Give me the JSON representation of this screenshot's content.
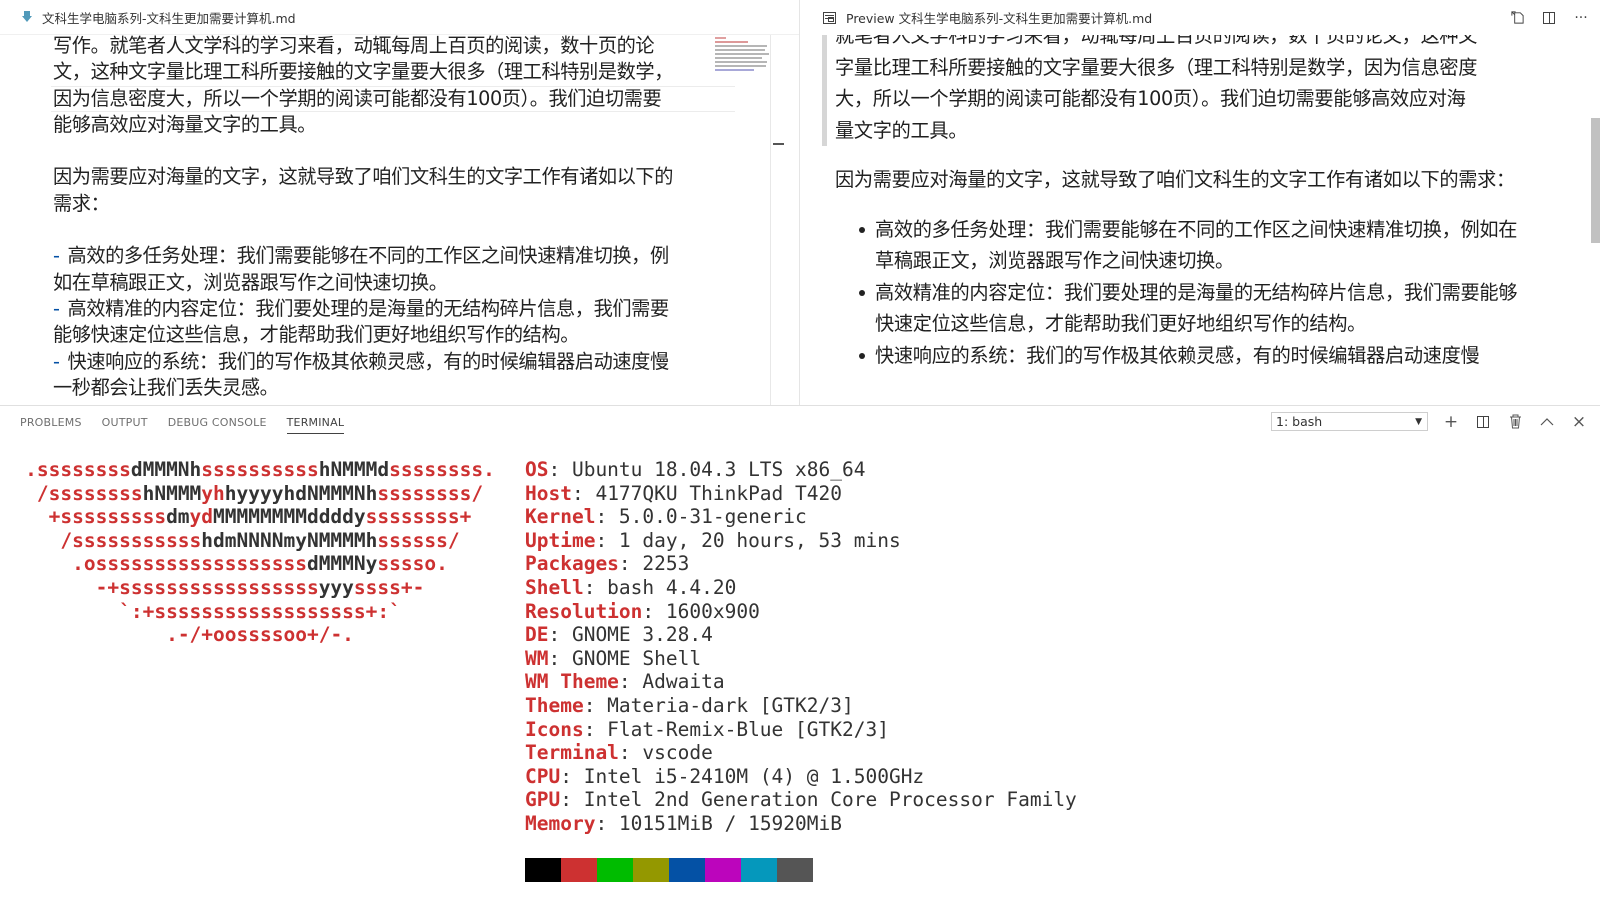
{
  "editor": {
    "tab_title": "文科生学电脑系列-文科生更加需要计算机.md",
    "lines": [
      "写作。就笔者人文学科的学习来看，动辄每周上百页的阅读，数十页的论",
      "文，这种文字量比理工科所要接触的文字量要大很多（理工科特别是数学，",
      "因为信息密度大，所以一个学期的阅读可能都没有100页）。我们迫切需要",
      "能够高效应对海量文字的工具。",
      "因为需要应对海量的文字，这就导致了咱们文科生的文字工作有诸如以下的",
      "需求：",
      "-",
      "高效的多任务处理：我们需要能够在不同的工作区之间快速精准切换，例",
      "如在草稿跟正文，浏览器跟写作之间快速切换。",
      "高效精准的内容定位：我们要处理的是海量的无结构碎片信息，我们需要",
      "能够快速定位这些信息，才能帮助我们更好地组织写作的结构。",
      "快速响应的系统：我们的写作极其依赖灵感，有的时候编辑器启动速度慢",
      "一秒都会让我们丢失灵感。"
    ]
  },
  "preview": {
    "tab_title": "Preview 文科生学电脑系列-文科生更加需要计算机.md",
    "actions": {
      "open_source": "open-source-icon",
      "split": "split-editor-icon",
      "more": "···"
    },
    "quote_lines": [
      "就笔者人文学科的学习来看，动辄每周上百页的阅读，数十页的论文，这种文",
      "字量比理工科所要接触的文字量要大很多（理工科特别是数学，因为信息密度",
      "大，所以一个学期的阅读可能都没有100页）。我们迫切需要能够高效应对海",
      "量文字的工具。"
    ],
    "paragraph": "因为需要应对海量的文字，这就导致了咱们文科生的文字工作有诸如以下的需求：",
    "list": [
      "高效的多任务处理：我们需要能够在不同的工作区之间快速精准切换，例如在草稿跟正文，浏览器跟写作之间快速切换。",
      "高效精准的内容定位：我们要处理的是海量的无结构碎片信息，我们需要能够快速定位这些信息，才能帮助我们更好地组织写作的结构。",
      "快速响应的系统：我们的写作极其依赖灵感，有的时候编辑器启动速度慢"
    ]
  },
  "panel": {
    "tabs": [
      "PROBLEMS",
      "OUTPUT",
      "DEBUG CONSOLE",
      "TERMINAL"
    ],
    "active_tab": "TERMINAL",
    "terminal_select": "1: bash",
    "actions": {
      "new": "+",
      "more_up": "^",
      "close": "×"
    }
  },
  "terminal": {
    "logo": [
      [
        {
          "t": ".ssssssss",
          "c": "r"
        },
        {
          "t": "dMMMNh",
          "c": "k"
        },
        {
          "t": "ssssssssss",
          "c": "r"
        },
        {
          "t": "hNMMMd",
          "c": "k"
        },
        {
          "t": "ssssssss.",
          "c": "r"
        }
      ],
      [
        {
          "t": "/ssssssss",
          "c": "r"
        },
        {
          "t": "hNMMM",
          "c": "k"
        },
        {
          "t": "yh",
          "c": "r"
        },
        {
          "t": "hyyyyhdNMMMNh",
          "c": "k"
        },
        {
          "t": "ssssssss/",
          "c": "r"
        }
      ],
      [
        {
          "t": "+sssssssss",
          "c": "r"
        },
        {
          "t": "dm",
          "c": "k"
        },
        {
          "t": "yd",
          "c": "r"
        },
        {
          "t": "MMMMMMMMddddy",
          "c": "k"
        },
        {
          "t": "ssssssss+",
          "c": "r"
        }
      ],
      [
        {
          "t": "/sssssssssss",
          "c": "r"
        },
        {
          "t": "hdmNNNNmyNMMMMh",
          "c": "k"
        },
        {
          "t": "ssssss/",
          "c": "r"
        }
      ],
      [
        {
          "t": ".ossssssssssssssssss",
          "c": "r"
        },
        {
          "t": "dMMMNy",
          "c": "k"
        },
        {
          "t": "sssso.",
          "c": "r"
        }
      ],
      [
        {
          "t": "-+sssssssssssssssss",
          "c": "r"
        },
        {
          "t": "yyy",
          "c": "k"
        },
        {
          "t": "ssss+-",
          "c": "r"
        }
      ],
      [
        {
          "t": "`:+ssssssssssssssssss+:`",
          "c": "r"
        }
      ],
      [
        {
          "t": ".-/+oossssoo+/-.",
          "c": "r"
        }
      ]
    ],
    "info": [
      {
        "key": "OS",
        "value": "Ubuntu 18.04.3 LTS x86_64"
      },
      {
        "key": "Host",
        "value": "4177QKU ThinkPad T420"
      },
      {
        "key": "Kernel",
        "value": "5.0.0-31-generic"
      },
      {
        "key": "Uptime",
        "value": "1 day, 20 hours, 53 mins"
      },
      {
        "key": "Packages",
        "value": "2253"
      },
      {
        "key": "Shell",
        "value": "bash 4.4.20"
      },
      {
        "key": "Resolution",
        "value": "1600x900"
      },
      {
        "key": "DE",
        "value": "GNOME 3.28.4"
      },
      {
        "key": "WM",
        "value": "GNOME Shell"
      },
      {
        "key": "WM Theme",
        "value": "Adwaita"
      },
      {
        "key": "Theme",
        "value": "Materia-dark [GTK2/3]"
      },
      {
        "key": "Icons",
        "value": "Flat-Remix-Blue [GTK2/3]"
      },
      {
        "key": "Terminal",
        "value": "vscode"
      },
      {
        "key": "CPU",
        "value": "Intel i5-2410M (4) @ 1.500GHz"
      },
      {
        "key": "GPU",
        "value": "Intel 2nd Generation Core Processor Family"
      },
      {
        "key": "Memory",
        "value": "10151MiB / 15920MiB"
      }
    ],
    "palette": [
      "#000000",
      "#cd3131",
      "#00bc00",
      "#949800",
      "#0451a5",
      "#bc05bc",
      "#0598bc",
      "#555555"
    ]
  }
}
